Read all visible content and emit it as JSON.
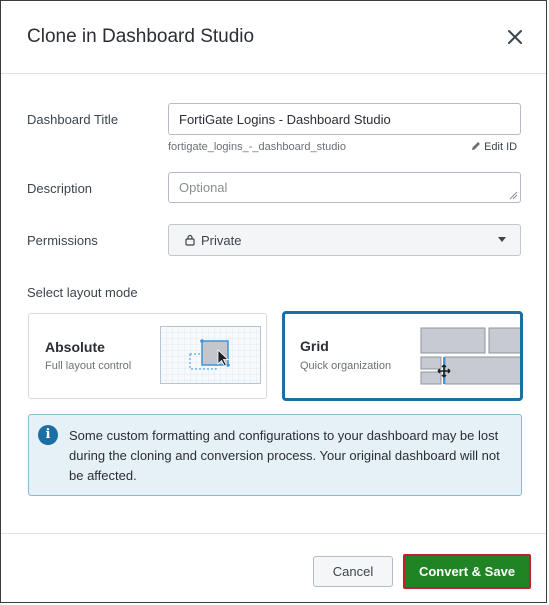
{
  "dialog": {
    "title": "Clone in Dashboard Studio"
  },
  "form": {
    "title_label": "Dashboard Title",
    "title_value": "FortiGate Logins - Dashboard Studio",
    "title_id": "fortigate_logins_-_dashboard_studio",
    "edit_id_label": "Edit ID",
    "description_label": "Description",
    "description_placeholder": "Optional",
    "permissions_label": "Permissions",
    "permissions_value": "Private",
    "layout_label": "Select layout mode"
  },
  "layout_modes": [
    {
      "title": "Absolute",
      "subtitle": "Full layout control",
      "selected": false
    },
    {
      "title": "Grid",
      "subtitle": "Quick organization",
      "selected": true
    }
  ],
  "info": {
    "icon": "info-icon",
    "text": "Some custom formatting and configurations to your dashboard may be lost during the cloning and conversion process. Your original dashboard will not be affected."
  },
  "buttons": {
    "cancel": "Cancel",
    "save": "Convert & Save"
  },
  "colors": {
    "accent": "#1b6fa3",
    "save": "#208324",
    "save_border": "#c0202a"
  }
}
